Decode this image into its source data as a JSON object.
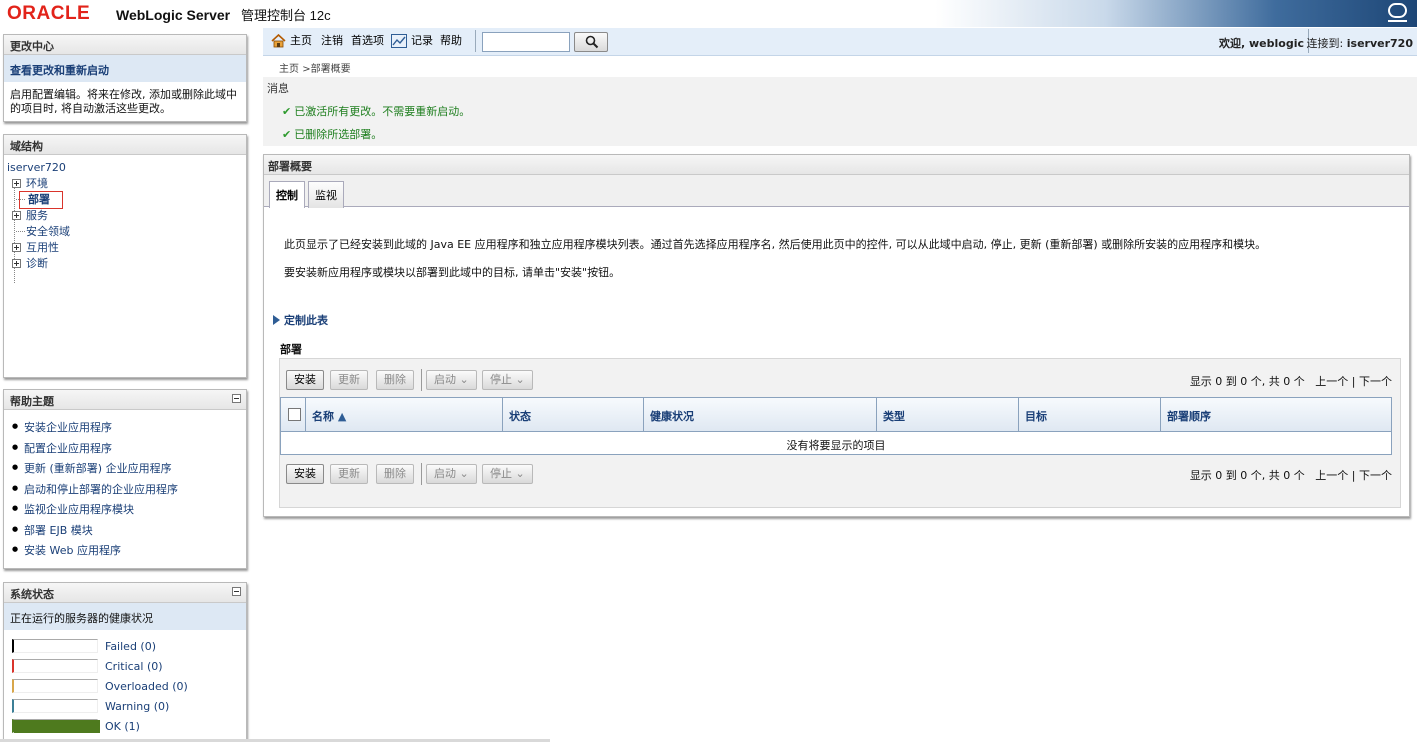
{
  "header": {
    "oracle_logo": "ORACLE",
    "product": "WebLogic Server",
    "subtitle": "管理控制台 12c"
  },
  "toolbar": {
    "home": "主页",
    "logout": "注销",
    "preferences": "首选项",
    "record": "记录",
    "help": "帮助",
    "search_value": "",
    "welcome": "欢迎, weblogic",
    "connected_label": "连接到:",
    "connected_server": "iserver720"
  },
  "change_center": {
    "title": "更改中心",
    "link": "查看更改和重新启动",
    "text": "启用配置编辑。将来在修改, 添加或删除此域中的项目时, 将自动激活这些更改。"
  },
  "domain_structure": {
    "title": "域结构",
    "root": "iserver720",
    "items": [
      "环境",
      "部署",
      "服务",
      "安全领域",
      "互用性",
      "诊断"
    ]
  },
  "help_topics": {
    "title": "帮助主题",
    "items": [
      "安装企业应用程序",
      "配置企业应用程序",
      "更新 (重新部署) 企业应用程序",
      "启动和停止部署的企业应用程序",
      "监视企业应用程序模块",
      "部署 EJB 模块",
      "安装 Web 应用程序"
    ]
  },
  "system_status": {
    "title": "系统状态",
    "subtitle": "正在运行的服务器的健康状况",
    "rows": [
      {
        "label": "Failed (0)",
        "color": "#000000",
        "fraction": 0
      },
      {
        "label": "Critical (0)",
        "color": "#d9342b",
        "fraction": 0
      },
      {
        "label": "Overloaded (0)",
        "color": "#d8a64a",
        "fraction": 0
      },
      {
        "label": "Warning (0)",
        "color": "#3c7f96",
        "fraction": 0
      },
      {
        "label": "OK (1)",
        "color": "#4e7a1e",
        "fraction": 1
      }
    ]
  },
  "breadcrumb": {
    "home": "主页",
    "sep": ">",
    "current": "部署概要"
  },
  "messages": {
    "title": "消息",
    "items": [
      "已激活所有更改。不需要重新启动。",
      "已删除所选部署。"
    ]
  },
  "main": {
    "title": "部署概要",
    "tabs": [
      "控制",
      "监视"
    ],
    "desc1": "此页显示了已经安装到此域的 Java EE 应用程序和独立应用程序模块列表。通过首先选择应用程序名, 然后使用此页中的控件, 可以从此域中启动, 停止, 更新 (重新部署) 或删除所安装的应用程序和模块。",
    "desc2": "要安装新应用程序或模块以部署到此域中的目标, 请单击\"安装\"按钮。",
    "customize": "定制此表",
    "section_title": "部署",
    "buttons": {
      "install": "安装",
      "update": "更新",
      "delete": "删除",
      "start": "启动",
      "stop": "停止"
    },
    "pager": {
      "showing": "显示 0 到 0 个, 共 0 个",
      "prev": "上一个",
      "sep": "|",
      "next": "下一个"
    },
    "columns": [
      "名称",
      "状态",
      "健康状况",
      "类型",
      "目标",
      "部署顺序"
    ],
    "empty": "没有将要显示的项目"
  }
}
